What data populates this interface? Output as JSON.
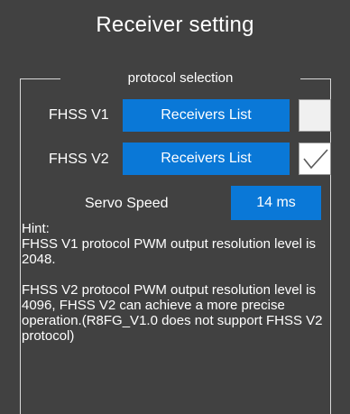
{
  "header": {
    "title": "Receiver setting"
  },
  "protocol_group": {
    "legend": "protocol selection",
    "rows": [
      {
        "label": "FHSS V1",
        "button_label": "Receivers List",
        "checked": false
      },
      {
        "label": "FHSS V2",
        "button_label": "Receivers List",
        "checked": true
      }
    ],
    "servo_speed": {
      "label": "Servo Speed",
      "value": "14 ms"
    },
    "hint": {
      "heading": "Hint:",
      "v1_text": "FHSS V1 protocol PWM output resolution level is 2048.",
      "v2_text": "FHSS V2 protocol PWM output resolution level is 4096, FHSS V2 can achieve a more precise operation.(R8FG_V1.0 does not support FHSS V2 protocol)"
    }
  },
  "colors": {
    "background": "#414141",
    "accent_blue": "#0a78d7",
    "text": "#ffffff",
    "frame_line": "#d8d8d8"
  },
  "icons": {
    "checkbox_checked": "checkmark-icon"
  }
}
